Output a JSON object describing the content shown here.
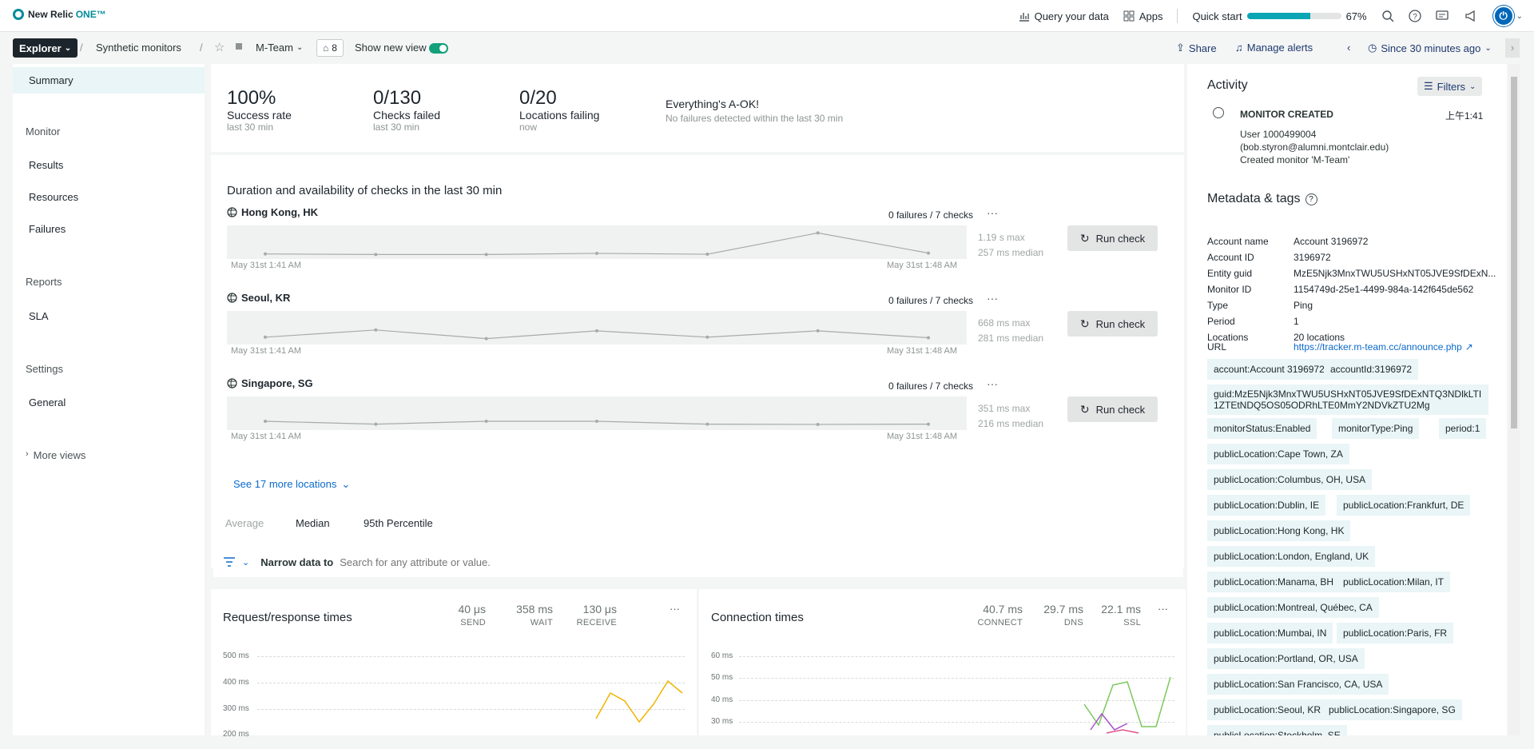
{
  "topbar": {
    "logo_text": "New Relic",
    "logo_one": "ONE™",
    "query": "Query your data",
    "apps": "Apps",
    "quick_start": "Quick start",
    "quick_start_progress": 67,
    "quick_start_pct": "67%"
  },
  "nav": {
    "explorer": "Explorer",
    "breadcrumb_1": "Synthetic monitors",
    "entity": "M-Team",
    "tag_count": "8",
    "show_new_view": "Show new view",
    "share": "Share",
    "manage_alerts": "Manage alerts",
    "time_range": "Since 30 minutes ago"
  },
  "sidebar": {
    "summary": "Summary",
    "monitor": "Monitor",
    "results": "Results",
    "resources": "Resources",
    "failures": "Failures",
    "reports": "Reports",
    "sla": "SLA",
    "settings": "Settings",
    "general": "General",
    "more_views": "More views"
  },
  "summary": {
    "success_value": "100%",
    "success_label": "Success rate",
    "success_sub": "last 30 min",
    "checks_value": "0/130",
    "checks_label": "Checks failed",
    "checks_sub": "last 30 min",
    "locations_value": "0/20",
    "locations_label": "Locations failing",
    "locations_sub": "now",
    "ok_title": "Everything's A-OK!",
    "ok_sub": "No failures detected within the last 30 min"
  },
  "duration": {
    "title": "Duration and availability of checks in the last 30 min",
    "see_more": "See 17 more locations",
    "run_check": "Run check",
    "locations": [
      {
        "name": "Hong Kong, HK",
        "fails": "0 failures / 7 checks",
        "max": "1.19 s max",
        "median": "257 ms median",
        "start": "May 31st 1:41 AM",
        "end": "May 31st 1:48 AM",
        "points": [
          0.12,
          0.1,
          0.1,
          0.14,
          0.11,
          0.85,
          0.15
        ]
      },
      {
        "name": "Seoul, KR",
        "fails": "0 failures / 7 checks",
        "max": "668 ms max",
        "median": "281 ms median",
        "start": "May 31st 1:41 AM",
        "end": "May 31st 1:48 AM",
        "points": [
          0.2,
          0.45,
          0.15,
          0.42,
          0.2,
          0.42,
          0.18
        ]
      },
      {
        "name": "Singapore, SG",
        "fails": "0 failures / 7 checks",
        "max": "351 ms max",
        "median": "216 ms median",
        "start": "May 31st 1:41 AM",
        "end": "May 31st 1:48 AM",
        "points": [
          0.25,
          0.15,
          0.25,
          0.25,
          0.15,
          0.14,
          0.15
        ]
      }
    ]
  },
  "filters": {
    "average": "Average",
    "median": "Median",
    "p95": "95th Percentile",
    "narrow": "Narrow data to",
    "placeholder": "Search for any attribute or value."
  },
  "request": {
    "title": "Request/response times",
    "send_v": "40 μs",
    "send_k": "SEND",
    "wait_v": "358 ms",
    "wait_k": "WAIT",
    "recv_v": "130 μs",
    "recv_k": "RECEIVE",
    "y": [
      "500 ms",
      "400 ms",
      "300 ms",
      "200 ms"
    ]
  },
  "connection": {
    "title": "Connection times",
    "connect_v": "40.7 ms",
    "connect_k": "CONNECT",
    "dns_v": "29.7 ms",
    "dns_k": "DNS",
    "ssl_v": "22.1 ms",
    "ssl_k": "SSL",
    "y": [
      "60 ms",
      "50 ms",
      "40 ms",
      "30 ms"
    ]
  },
  "activity": {
    "title": "Activity",
    "filters": "Filters",
    "event": "MONITOR CREATED",
    "time": "上午1:41",
    "user": "User 1000499004",
    "email": "(bob.styron@alumni.montclair.edu)",
    "desc": "Created monitor 'M-Team'"
  },
  "metadata": {
    "title": "Metadata & tags",
    "rows": [
      {
        "k": "Account name",
        "v": "Account 3196972"
      },
      {
        "k": "Account ID",
        "v": "3196972"
      },
      {
        "k": "Entity guid",
        "v": "MzE5Njk3MnxTWU5USHxNT05JVE9SfDExN..."
      },
      {
        "k": "Monitor ID",
        "v": "1154749d-25e1-4499-984a-142f645de562"
      },
      {
        "k": "Type",
        "v": "Ping"
      },
      {
        "k": "Period",
        "v": "1"
      },
      {
        "k": "Locations",
        "v": "20 locations"
      }
    ],
    "url_k": "URL",
    "url_v": "https://tracker.m-team.cc/announce.php",
    "tags": [
      "account:Account 3196972",
      "accountId:3196972",
      "guid:MzE5Njk3MnxTWU5USHxNT05JVE9SfDExNTQ3NDlkLTI1ZTEtNDQ5OS05ODRhLTE0MmY2NDVkZTU2Mg",
      "monitorStatus:Enabled",
      "monitorType:Ping",
      "period:1",
      "publicLocation:Cape Town, ZA",
      "publicLocation:Columbus, OH, USA",
      "publicLocation:Dublin, IE",
      "publicLocation:Frankfurt, DE",
      "publicLocation:Hong Kong, HK",
      "publicLocation:London, England, UK",
      "publicLocation:Manama, BH",
      "publicLocation:Milan, IT",
      "publicLocation:Montreal, Québec, CA",
      "publicLocation:Mumbai, IN",
      "publicLocation:Paris, FR",
      "publicLocation:Portland, OR, USA",
      "publicLocation:San Francisco, CA, USA",
      "publicLocation:Seoul, KR",
      "publicLocation:Singapore, SG",
      "publicLocation:Stockholm, SE"
    ]
  }
}
